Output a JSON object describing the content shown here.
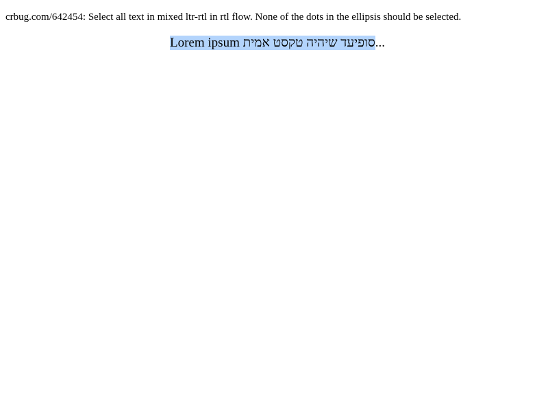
{
  "description": {
    "text": "crbug.com/642454: Select all text in mixed ltr-rtl in rtl flow. None of the dots in the ellipsis should be selected."
  },
  "test_line": {
    "ltr_text": "Lorem ipsum",
    "rtl_text": "סופיעד שיהיה טקסט אמית",
    "ellipsis": "..."
  },
  "colors": {
    "selection_highlight": "#b3d4fc",
    "text": "#000000",
    "background": "#ffffff"
  }
}
